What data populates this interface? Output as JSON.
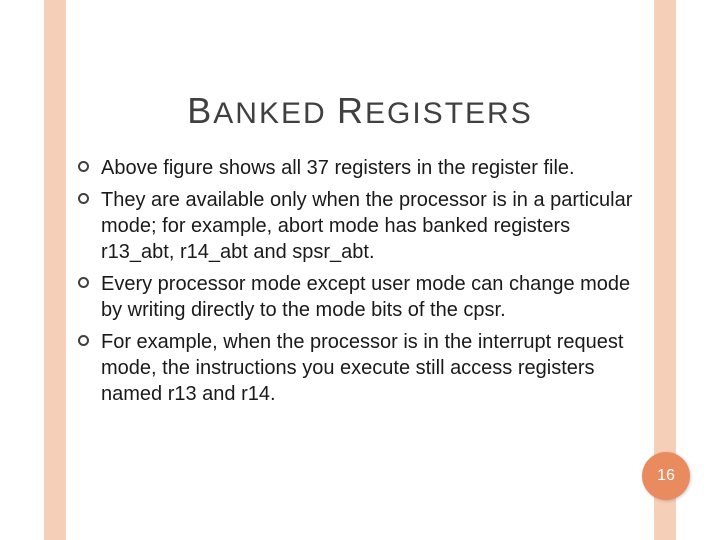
{
  "title_parts": {
    "b": "B",
    "anked": "ANKED ",
    "r": "R",
    "egisters": "EGISTERS"
  },
  "bullets": [
    "Above figure shows all 37 registers in the register file.",
    "They are available only when the processor is in a particular mode; for example, abort mode has banked registers r13_abt, r14_abt and spsr_abt.",
    "Every processor mode except user mode can change mode by writing directly to the mode bits of the cpsr.",
    "For example, when the processor is in the interrupt request mode, the instructions you execute still access registers named r13 and r14."
  ],
  "page_number": "16"
}
